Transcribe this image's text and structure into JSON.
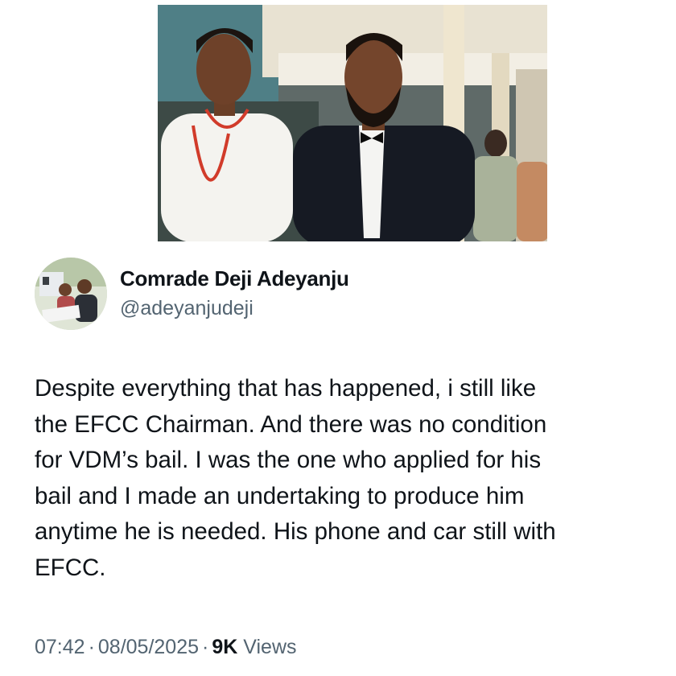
{
  "author": {
    "display_name": "Comrade Deji Adeyanju",
    "handle": "@adeyanjudeji"
  },
  "tweet": {
    "lines": [
      "Despite everything that has happened, i still like",
      "the EFCC Chairman. And there was no condition",
      "for VDM’s bail. I was the one who applied for his",
      "bail and I made an undertaking to produce him",
      "anytime he is needed. His phone and car still with",
      "EFCC."
    ]
  },
  "meta": {
    "time": "07:42",
    "date": "08/05/2025",
    "views_count": "9K",
    "views_label": "Views",
    "separator": "·"
  },
  "colors": {
    "text_primary": "#0f1419",
    "text_secondary": "#536471",
    "background": "#ffffff"
  }
}
